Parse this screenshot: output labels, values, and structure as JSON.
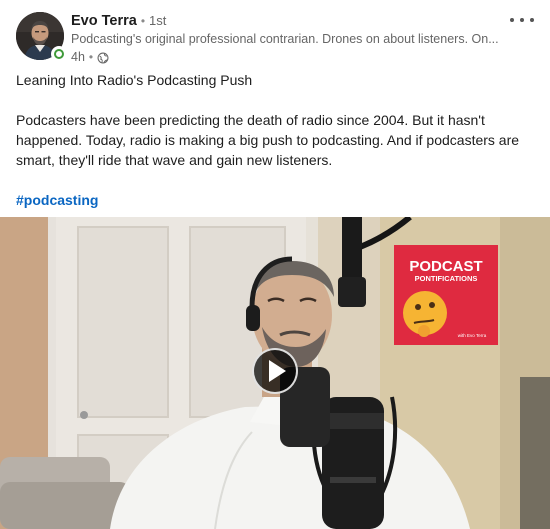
{
  "author": {
    "name": "Evo Terra",
    "degree": "1st",
    "headline": "Podcasting's original professional contrarian. Drones on about listeners. On...",
    "time": "4h",
    "visibility_icon": "globe-icon"
  },
  "post": {
    "title": "Leaning Into Radio's Podcasting Push",
    "body": "Podcasters have been predicting the death of radio since 2004. But it hasn't happened. Today, radio is making a big push to podcasting. And if podcasters are smart, they'll ride that wave and gain new listeners.",
    "hashtag": "#podcasting"
  },
  "video": {
    "poster_sign_line1": "PODCAST",
    "poster_sign_line2": "PONTIFICATIONS",
    "poster_sign_small": "with Evo Terra",
    "sign_color": "#e0263f"
  },
  "colors": {
    "link": "#0a66c2",
    "presence": "#3f9a3a",
    "text": "#1d1d1d",
    "muted": "#666666"
  }
}
